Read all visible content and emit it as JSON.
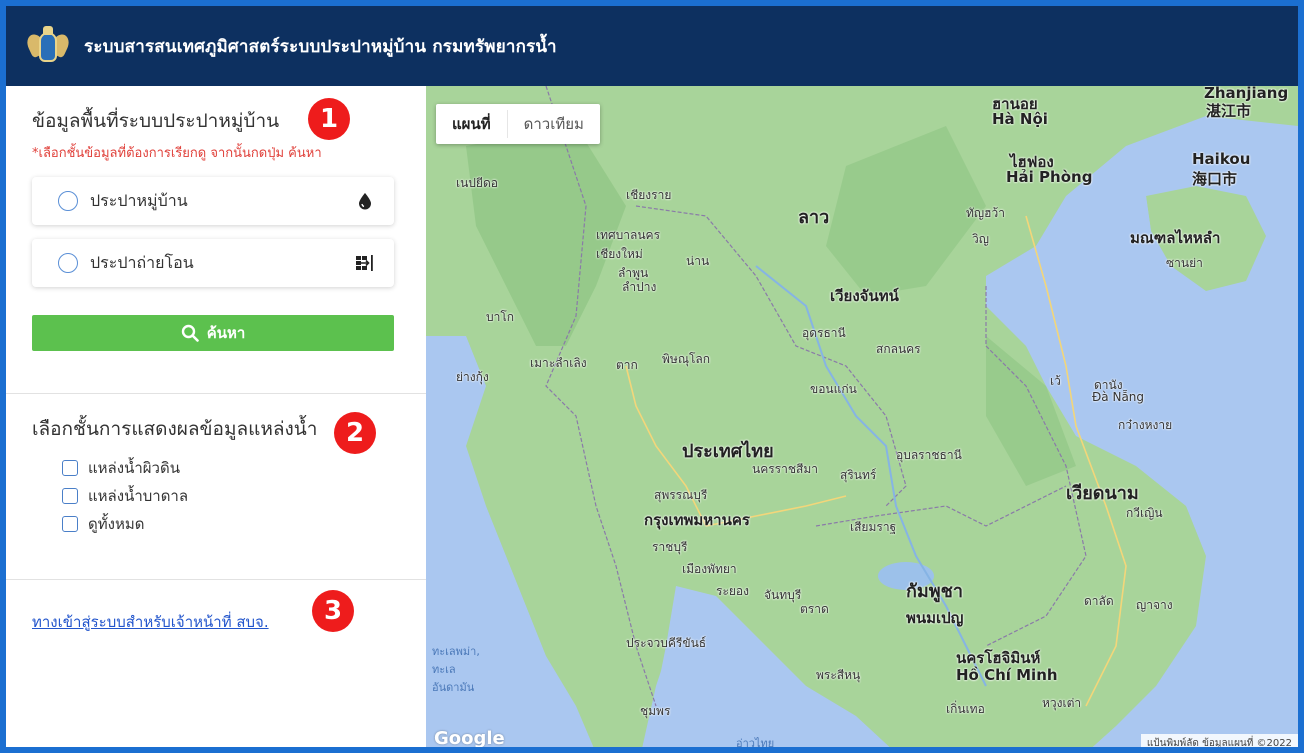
{
  "header": {
    "title": "ระบบสารสนเทศภูมิศาสตร์ระบบประปาหมู่บ้าน กรมทรัพยากรน้ำ"
  },
  "sidebar": {
    "section1": {
      "badge": "1",
      "title": "ข้อมูลพื้นที่ระบบประปาหมู่บ้าน",
      "hint": "*เลือกชั้นข้อมูลที่ต้องการเรียกดู จากนั้นกดปุ่ม ค้นหา",
      "options": [
        {
          "label": "ประปาหมู่บ้าน",
          "icon": "water-drop-icon"
        },
        {
          "label": "ประปาถ่ายโอน",
          "icon": "transfer-icon"
        }
      ],
      "search_label": "ค้นหา"
    },
    "section2": {
      "badge": "2",
      "title": "เลือกชั้นการแสดงผลข้อมูลแหล่งน้ำ",
      "checks": [
        {
          "label": "แหล่งน้ำผิวดิน"
        },
        {
          "label": "แหล่งน้ำบาดาล"
        },
        {
          "label": "ดูทั้งหมด"
        }
      ]
    },
    "section3": {
      "badge": "3",
      "link_label": "ทางเข้าสู่ระบบสำหรับเจ้าหน้าที่ สบจ."
    }
  },
  "map": {
    "type_buttons": [
      "แผนที่",
      "ดาวเทียม"
    ],
    "active_type": "แผนที่",
    "labels": {
      "hanoi": "ฮานอย",
      "hanoi_en": "Hà Nội",
      "haiphong": "ไฮฟอง",
      "haiphong_en": "Hải Phòng",
      "haikou": "Haikou",
      "haikou_cn": "海口市",
      "zhanjiang": "Zhanjiang",
      "zhanjiang_cn": "湛江市",
      "naypyidaw": "เนปยีดอ",
      "chiangrai": "เชียงราย",
      "chiangmai": "เทศบาลนคร เชียงใหม่",
      "lamphun": "ลำพูน",
      "lampang": "ลำปาง",
      "nan": "น่าน",
      "laos": "ลาว",
      "thanhhoa": "ทัญฮว้า",
      "vinh": "วิญ",
      "hainan": "มณฑลไหหลำ",
      "sanya": "ซานย่า",
      "vientiane": "เวียงจันทน์",
      "udon": "อุดรธานี",
      "sakon": "สกลนคร",
      "bago": "บาโก",
      "maesot": "เมาะลำเลิง",
      "tak": "ตาก",
      "phitsanulok": "พิษณุโลก",
      "yangon": "ย่างกุ้ง",
      "khonkaen": "ขอนแก่น",
      "hue": "เว้",
      "danang": "ดานัง",
      "danang_en": "Đà Nẵng",
      "quangngai": "กว๋างหงาย",
      "thailand": "ประเทศไทย",
      "ubon": "อุบลราชธานี",
      "korat": "นครราชสีมา",
      "surin": "สุรินทร์",
      "vietnam": "เวียดนาม",
      "suphan": "สุพรรณบุรี",
      "bangkok": "กรุงเทพมหานคร",
      "siemreap": "เสียมราฐ",
      "quinhon": "กวีเญิน",
      "ratchaburi": "ราชบุรี",
      "pattaya": "เมืองพัทยา",
      "rayong": "ระยอง",
      "chanthaburi": "จันทบุรี",
      "trat": "ตราด",
      "cambodia": "กัมพูชา",
      "phnompenh": "พนมเปญ",
      "dalat": "ดาลัด",
      "nhatrang": "ญาจาง",
      "prachuap": "ประจวบคีรีขันธ์",
      "hochiminh": "นครโฮจิมินห์",
      "hochiminh_en": "Hồ Chí Minh",
      "andaman": "ทะเลพม่า, ทะเล อันดามัน",
      "chumphon": "ชุมพร",
      "gulf": "อ่าวไทย",
      "sihanouk": "พระสีหนุ",
      "cantho": "เกิ่นเทอ",
      "vungtau": "หวุงเต่า"
    },
    "google_logo": "Google",
    "attribution": "แป้นพิมพ์ลัด   ข้อมูลแผนที่ ©2022"
  },
  "colors": {
    "header_bg": "#0d3060",
    "badge": "#ee1c1c",
    "search_button": "#5cc14e",
    "hint_text": "#e0403a",
    "link": "#2255cc",
    "frame": "#1b6fd1"
  }
}
